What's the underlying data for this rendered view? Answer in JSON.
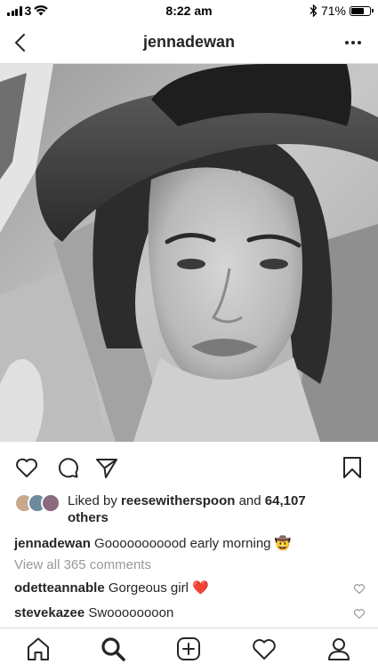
{
  "status_bar": {
    "carrier": "3",
    "time": "8:22 am",
    "battery": "71%",
    "battery_level": 0.71
  },
  "header": {
    "username": "jennadewan",
    "back_icon": "chevron-left-icon",
    "more_icon": "more-horizontal-icon"
  },
  "post": {
    "image_icon": "photo",
    "actions": {
      "like_icon": "heart-outline-icon",
      "comment_icon": "comment-icon",
      "share_icon": "paper-plane-icon",
      "save_icon": "bookmark-icon"
    },
    "likes": {
      "prefix": "Liked by",
      "user": "reesewitherspoon",
      "and": "and",
      "count": "64,107",
      "others": "others"
    },
    "caption": {
      "user": "jennadewan",
      "text": "Gooooooooood early morning",
      "emoji": "🤠"
    },
    "view_all": "View all 365 comments",
    "comments": [
      {
        "user": "odetteannable",
        "text": "Gorgeous girl",
        "emoji": "❤️"
      },
      {
        "user": "stevekazee",
        "text": "Swoooooooon",
        "emoji": ""
      }
    ]
  },
  "tab_bar": {
    "items": [
      "home-icon",
      "search-icon",
      "new-post-icon",
      "activity-heart-icon",
      "profile-icon"
    ]
  },
  "colors": {
    "text": "#262626",
    "secondary": "#999999",
    "divider": "#dbdbdb",
    "heart_red": "#ed4956"
  }
}
